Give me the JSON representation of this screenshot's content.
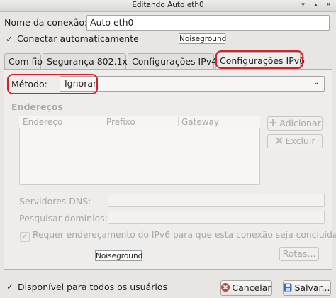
{
  "window": {
    "title": "Editando Auto eth0"
  },
  "connection_name": {
    "label": "Nome da conexão:",
    "value": "Auto eth0"
  },
  "auto_connect": {
    "label": "Conectar automaticamente",
    "checked": true
  },
  "watermark_top": "Noiseground",
  "tabs": [
    {
      "label": "Com fio"
    },
    {
      "label": "Segurança 802.1x"
    },
    {
      "label": "Configurações IPv4"
    },
    {
      "label": "Configurações IPv6",
      "active": true
    }
  ],
  "method": {
    "label": "Método:",
    "value": "Ignorar"
  },
  "addresses": {
    "section_label": "Endereços",
    "columns": [
      "Endereço",
      "Prefixo",
      "Gateway"
    ],
    "add_label": "Adicionar",
    "delete_label": "Excluir"
  },
  "dns": {
    "label": "Servidores DNS:",
    "value": ""
  },
  "search_domains": {
    "label": "Pesquisar domínios:",
    "value": ""
  },
  "require_ipv6": {
    "label": "Requer endereçamento do IPv6 para que esta conexão seja concluída",
    "checked": true
  },
  "watermark_bottom": "Noiseground",
  "routes_label": "Rotas...",
  "available_all_users": {
    "label": "Disponível para todos os usuários",
    "checked": true
  },
  "cancel_label": "Cancelar",
  "save_label": "Salvar...",
  "colors": {
    "highlight": "#d9202a",
    "cancel_icon": "#d83b2f",
    "save_icon": "#3b6fb5"
  }
}
